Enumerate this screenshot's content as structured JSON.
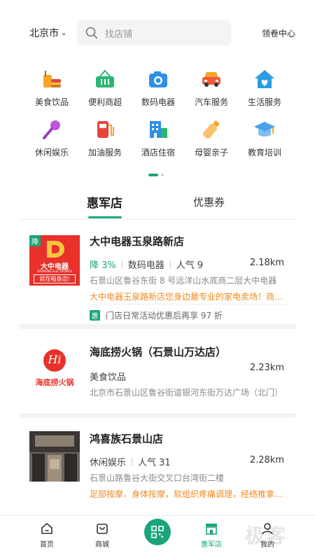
{
  "header": {
    "city": "北京市",
    "search_placeholder": "找店铺",
    "coupon_center": "领卷中心"
  },
  "categories": [
    {
      "label": "美食饮品",
      "icon": "food-drink-icon",
      "color": "#f5a623"
    },
    {
      "label": "便利商超",
      "icon": "shopping-basket-icon",
      "color": "#2bb673"
    },
    {
      "label": "数码电器",
      "icon": "camera-icon",
      "color": "#2f8fe8"
    },
    {
      "label": "汽车服务",
      "icon": "car-icon",
      "color": "#f15a3c"
    },
    {
      "label": "生活服务",
      "icon": "house-icon",
      "color": "#2a9de0"
    },
    {
      "label": "休闲娱乐",
      "icon": "microphone-icon",
      "color": "#c054e0"
    },
    {
      "label": "加油服务",
      "icon": "gas-station-icon",
      "color": "#e8443a"
    },
    {
      "label": "酒店住宿",
      "icon": "hotel-icon",
      "color": "#2f8fe8"
    },
    {
      "label": "母婴亲子",
      "icon": "baby-bottle-icon",
      "color": "#f5a623"
    },
    {
      "label": "教育培训",
      "icon": "graduation-cap-icon",
      "color": "#4aa3e8"
    }
  ],
  "tabs": {
    "active": "惠军店",
    "inactive": "优惠券"
  },
  "stores": [
    {
      "name": "大中电器玉泉路新店",
      "badge": "降",
      "logo_text_cn": "大中电器",
      "logo_text_en": "DAZHONG ELECTRONICS",
      "logo_slogan": "就在咱身边!",
      "discount": "降 3%",
      "category": "数码电器",
      "popularity": "人气 9",
      "distance": "2.18km",
      "address": "石景山区鲁谷东街 8 号远洋山水底商二层大中电器",
      "promo": "大中电器玉泉路新店您身边最专业的家电卖场！商品齐全",
      "hui_badge": "惠",
      "hui_text": "门店日常活动优惠后再享 97 折"
    },
    {
      "name": "海底捞火锅（石景山万达店）",
      "logo_text_cn": "海底捞火锅",
      "logo_mark": "Hi",
      "category": "美食饮品",
      "distance": "2.23km",
      "address": "北京市石景山区鲁谷街道银河东街万达广场（北门）"
    },
    {
      "name": "鸿喜族石景山店",
      "category": "休闲娱乐",
      "popularity": "人气 31",
      "distance": "2.28km",
      "address": "石景山路鲁谷大街交叉口台湾街二楼",
      "promo": "足部按摩，身体按摩，软组织疼痛调理，经络推拿，拔罐刮痧"
    }
  ],
  "bottom_nav": [
    {
      "label": "首页",
      "icon": "home-icon"
    },
    {
      "label": "商城",
      "icon": "shopping-bag-icon"
    },
    {
      "label": "",
      "icon": "qr-scan-icon"
    },
    {
      "label": "惠军店",
      "icon": "hui-store-icon"
    },
    {
      "label": "我的",
      "icon": "user-icon"
    }
  ],
  "watermark": "极客"
}
